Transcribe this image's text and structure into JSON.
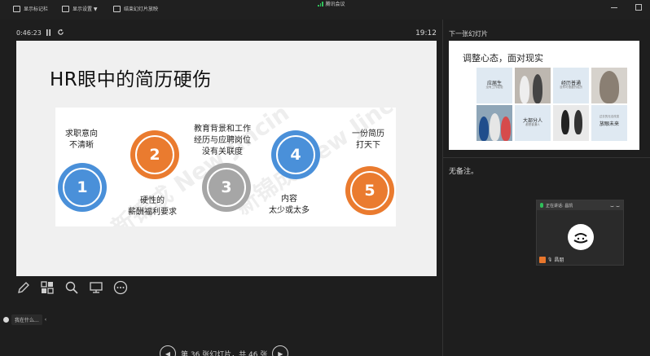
{
  "toolbar": {
    "items": [
      {
        "label": "显示标记栏"
      },
      {
        "label": "显示设置 ▼"
      },
      {
        "label": "结束幻灯片放映"
      }
    ],
    "meeting_name": "腾讯会议"
  },
  "timer": {
    "elapsed": "0:46:23",
    "pause_icon": "pause-icon",
    "reset_icon": "reset-icon",
    "clock": "19:12"
  },
  "current_slide": {
    "title": "HR眼中的简历硬伤",
    "watermark": "新锦成 New Jincin",
    "bubbles": [
      {
        "number": "1",
        "color": "#4a90d9"
      },
      {
        "number": "2",
        "color": "#ea7b2f"
      },
      {
        "number": "3",
        "color": "#a6a6a6"
      },
      {
        "number": "4",
        "color": "#4a90d9"
      },
      {
        "number": "5",
        "color": "#ea7b2f"
      }
    ],
    "captions": {
      "c1_line1": "求职意向",
      "c1_line2": "不清晰",
      "c2_line1": "硬性的",
      "c2_line2": "薪酬福利要求",
      "c3_line1": "教育背景和工作",
      "c3_line2": "经历与应聘岗位",
      "c3_line3": "没有关联度",
      "c4_line1": "内容",
      "c4_line2": "太少或太多",
      "c5_line1": "一份简历",
      "c5_line2": "打天下"
    }
  },
  "slide_tools": [
    "pen-icon",
    "slides-grid-icon",
    "zoom-icon",
    "screen-icon",
    "more-icon"
  ],
  "presenter_chip": {
    "label": "我在什么..."
  },
  "navigation": {
    "prev_icon": "prev-icon",
    "label": "第 36 张幻灯片，共 46 张",
    "next_icon": "next-icon"
  },
  "next_panel": {
    "label": "下一张幻灯片",
    "title": "调整心态，面对现实",
    "cells": {
      "c1_title": "应届生",
      "c1_sub": "没有工作经验",
      "c2_title": "经历普通",
      "c2_sub": "没有可借鉴的经历",
      "c3_title": "大部分人",
      "c3_sub": "都是普通人",
      "c4_title": "放眼未来",
      "c4_sub": "过去的无法改变"
    }
  },
  "notes": "无备注。",
  "speaker_tile": {
    "status": "正在讲话: 昌凯",
    "name": "昌朋"
  },
  "colors": {
    "accent_blue": "#4a90d9",
    "accent_orange": "#ea7b2f",
    "accent_gray": "#a6a6a6",
    "speaking_green": "#2fbf5a"
  }
}
